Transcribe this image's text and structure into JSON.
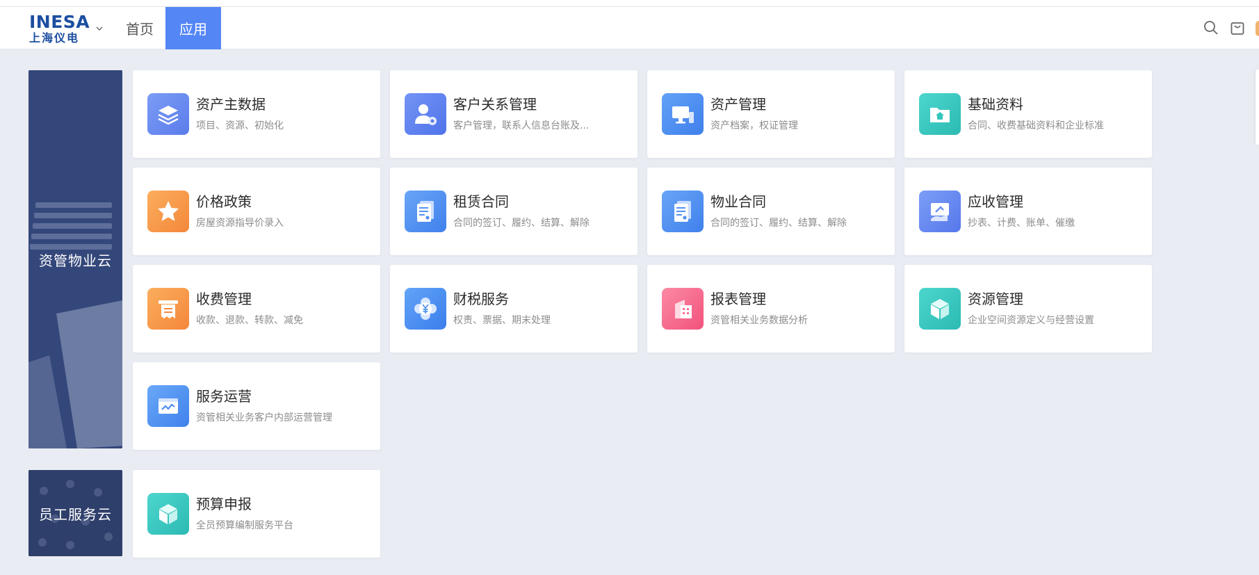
{
  "header": {
    "logo": {
      "en": "INESA",
      "cn": "上海仪电"
    },
    "nav": [
      {
        "label": "首页",
        "active": false
      },
      {
        "label": "应用",
        "active": true
      }
    ]
  },
  "groups": [
    {
      "label": "资管物业云",
      "apps": [
        {
          "title": "资产主数据",
          "desc": "项目、资源、初始化",
          "icon": "layers-icon",
          "color": "#6b8cf2"
        },
        {
          "title": "客户关系管理",
          "desc": "客户管理，联系人信息台账及...",
          "icon": "user-gear-icon",
          "color": "#5e84f0"
        },
        {
          "title": "资产管理",
          "desc": "资产档案，权证管理",
          "icon": "monitor-icon",
          "color": "#4f8df2"
        },
        {
          "title": "基础资料",
          "desc": "合同、收费基础资料和企业标准",
          "icon": "folder-home-icon",
          "color": "#37c9c3"
        },
        {
          "title": "价格政策",
          "desc": "房屋资源指导价录入",
          "icon": "star-icon",
          "color": "#f59a48"
        },
        {
          "title": "租赁合同",
          "desc": "合同的签订、履约、结算、解除",
          "icon": "contract-icon",
          "color": "#5592f2"
        },
        {
          "title": "物业合同",
          "desc": "合同的签订、履约、结算、解除",
          "icon": "contract-icon",
          "color": "#5592f2"
        },
        {
          "title": "应收管理",
          "desc": "抄表、计费、账单、催缴",
          "icon": "receivable-icon",
          "color": "#6a8ef3"
        },
        {
          "title": "收费管理",
          "desc": "收款、退款、转款、减免",
          "icon": "receipt-icon",
          "color": "#f59a48"
        },
        {
          "title": "财税服务",
          "desc": "权责、票据、期末处理",
          "icon": "yuan-flower-icon",
          "color": "#4f95f3"
        },
        {
          "title": "报表管理",
          "desc": "资管相关业务数据分析",
          "icon": "building-report-icon",
          "color": "#f76f92"
        },
        {
          "title": "资源管理",
          "desc": "企业空间资源定义与经营设置",
          "icon": "cube-icon",
          "color": "#34c6bf"
        },
        {
          "title": "服务运营",
          "desc": "资管相关业务客户内部运营管理",
          "icon": "chart-window-icon",
          "color": "#5597f3"
        }
      ]
    },
    {
      "label": "员工服务云",
      "apps": [
        {
          "title": "预算申报",
          "desc": "全员预算编制服务平台",
          "icon": "cube-icon",
          "color": "#34c6bf"
        }
      ]
    }
  ]
}
